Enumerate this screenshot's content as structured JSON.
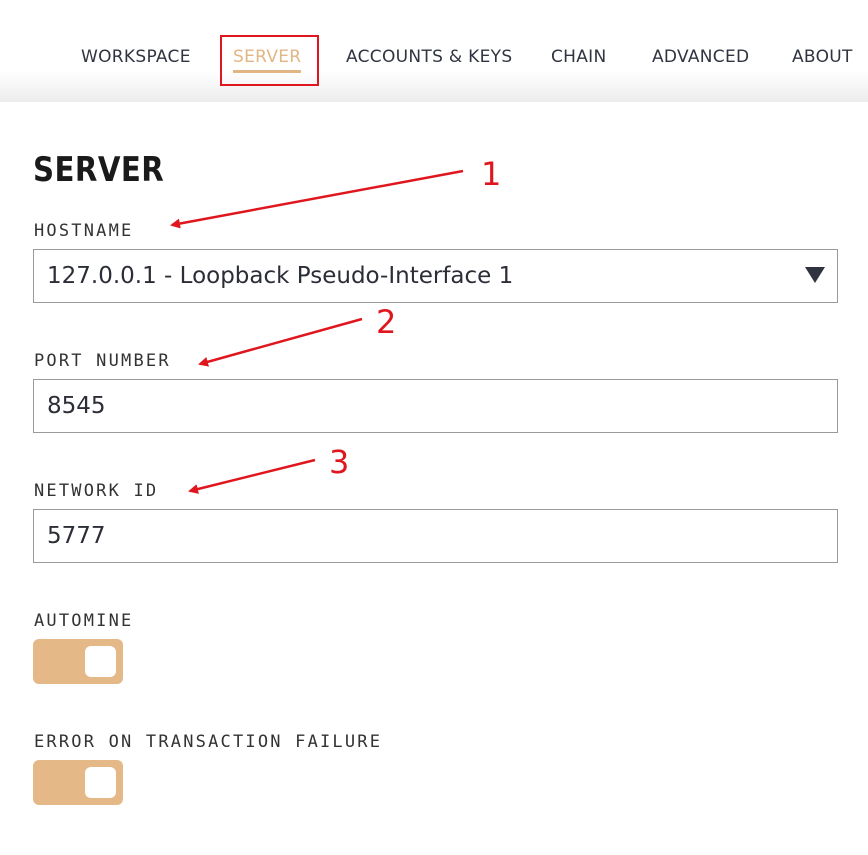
{
  "nav": {
    "tabs": [
      {
        "label": "WORKSPACE"
      },
      {
        "label": "SERVER"
      },
      {
        "label": "ACCOUNTS & KEYS"
      },
      {
        "label": "CHAIN"
      },
      {
        "label": "ADVANCED"
      },
      {
        "label": "ABOUT"
      }
    ],
    "active_tab": "SERVER"
  },
  "page": {
    "title": "SERVER"
  },
  "fields": {
    "hostname": {
      "label": "HOSTNAME",
      "value": "127.0.0.1 - Loopback Pseudo-Interface 1"
    },
    "port": {
      "label": "PORT NUMBER",
      "value": "8545"
    },
    "network_id": {
      "label": "NETWORK ID",
      "value": "5777"
    }
  },
  "toggles": {
    "automine": {
      "label": "AUTOMINE",
      "enabled": true
    },
    "error_on_failure": {
      "label": "ERROR ON TRANSACTION FAILURE",
      "enabled": true
    }
  },
  "annotations": {
    "markers": [
      "1",
      "2",
      "3"
    ],
    "color": "#e0161e"
  },
  "colors": {
    "accent": "#e2b684",
    "toggle_on": "#e4b887",
    "highlight": "#e0161e"
  }
}
